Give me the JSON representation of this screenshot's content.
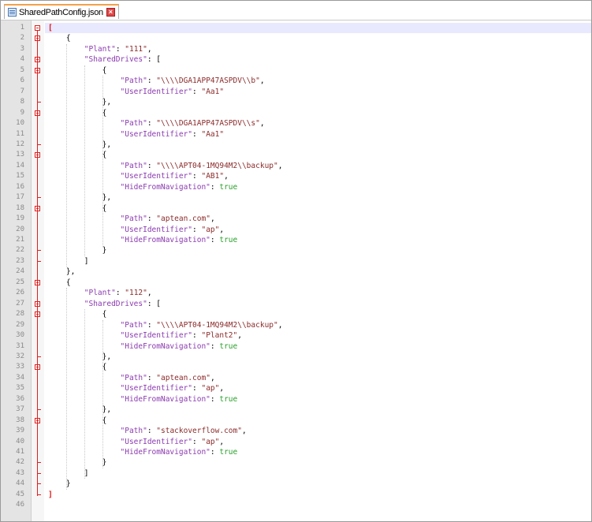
{
  "tab": {
    "filename": "SharedPathConfig.json"
  },
  "colors": {
    "key": "#8b3bb0",
    "string": "#8b2a2a",
    "boolean": "#2aa02a",
    "fold_marker": "#e02020",
    "tab_accent": "#f2a14b"
  },
  "icons": {
    "file": "file-icon",
    "close": "close-icon"
  },
  "lines": [
    [
      [
        "brace-hl",
        "["
      ]
    ],
    [
      [
        "p",
        "    {"
      ]
    ],
    [
      [
        "p",
        "        "
      ],
      [
        "k",
        "\"Plant\""
      ],
      [
        "p",
        ": "
      ],
      [
        "s",
        "\"111\""
      ],
      [
        "p",
        ","
      ]
    ],
    [
      [
        "p",
        "        "
      ],
      [
        "k",
        "\"SharedDrives\""
      ],
      [
        "p",
        ": ["
      ]
    ],
    [
      [
        "p",
        "            {"
      ]
    ],
    [
      [
        "p",
        "                "
      ],
      [
        "k",
        "\"Path\""
      ],
      [
        "p",
        ": "
      ],
      [
        "s",
        "\"\\\\\\\\DGA1APP47ASPDV\\\\b\""
      ],
      [
        "p",
        ","
      ]
    ],
    [
      [
        "p",
        "                "
      ],
      [
        "k",
        "\"UserIdentifier\""
      ],
      [
        "p",
        ": "
      ],
      [
        "s",
        "\"Aa1\""
      ]
    ],
    [
      [
        "p",
        "            },"
      ]
    ],
    [
      [
        "p",
        "            {"
      ]
    ],
    [
      [
        "p",
        "                "
      ],
      [
        "k",
        "\"Path\""
      ],
      [
        "p",
        ": "
      ],
      [
        "s",
        "\"\\\\\\\\DGA1APP47ASPDV\\\\s\""
      ],
      [
        "p",
        ","
      ]
    ],
    [
      [
        "p",
        "                "
      ],
      [
        "k",
        "\"UserIdentifier\""
      ],
      [
        "p",
        ": "
      ],
      [
        "s",
        "\"Aa1\""
      ]
    ],
    [
      [
        "p",
        "            },"
      ]
    ],
    [
      [
        "p",
        "            {"
      ]
    ],
    [
      [
        "p",
        "                "
      ],
      [
        "k",
        "\"Path\""
      ],
      [
        "p",
        ": "
      ],
      [
        "s",
        "\"\\\\\\\\APT04-1MQ94M2\\\\backup\""
      ],
      [
        "p",
        ","
      ]
    ],
    [
      [
        "p",
        "                "
      ],
      [
        "k",
        "\"UserIdentifier\""
      ],
      [
        "p",
        ": "
      ],
      [
        "s",
        "\"AB1\""
      ],
      [
        "p",
        ","
      ]
    ],
    [
      [
        "p",
        "                "
      ],
      [
        "k",
        "\"HideFromNavigation\""
      ],
      [
        "p",
        ": "
      ],
      [
        "b",
        "true"
      ]
    ],
    [
      [
        "p",
        "            },"
      ]
    ],
    [
      [
        "p",
        "            {"
      ]
    ],
    [
      [
        "p",
        "                "
      ],
      [
        "k",
        "\"Path\""
      ],
      [
        "p",
        ": "
      ],
      [
        "s",
        "\"aptean.com\""
      ],
      [
        "p",
        ","
      ]
    ],
    [
      [
        "p",
        "                "
      ],
      [
        "k",
        "\"UserIdentifier\""
      ],
      [
        "p",
        ": "
      ],
      [
        "s",
        "\"ap\""
      ],
      [
        "p",
        ","
      ]
    ],
    [
      [
        "p",
        "                "
      ],
      [
        "k",
        "\"HideFromNavigation\""
      ],
      [
        "p",
        ": "
      ],
      [
        "b",
        "true"
      ]
    ],
    [
      [
        "p",
        "            }"
      ]
    ],
    [
      [
        "p",
        "        ]"
      ]
    ],
    [
      [
        "p",
        "    },"
      ]
    ],
    [
      [
        "p",
        "    {"
      ]
    ],
    [
      [
        "p",
        "        "
      ],
      [
        "k",
        "\"Plant\""
      ],
      [
        "p",
        ": "
      ],
      [
        "s",
        "\"112\""
      ],
      [
        "p",
        ","
      ]
    ],
    [
      [
        "p",
        "        "
      ],
      [
        "k",
        "\"SharedDrives\""
      ],
      [
        "p",
        ": ["
      ]
    ],
    [
      [
        "p",
        "            {"
      ]
    ],
    [
      [
        "p",
        "                "
      ],
      [
        "k",
        "\"Path\""
      ],
      [
        "p",
        ": "
      ],
      [
        "s",
        "\"\\\\\\\\APT04-1MQ94M2\\\\backup\""
      ],
      [
        "p",
        ","
      ]
    ],
    [
      [
        "p",
        "                "
      ],
      [
        "k",
        "\"UserIdentifier\""
      ],
      [
        "p",
        ": "
      ],
      [
        "s",
        "\"Plant2\""
      ],
      [
        "p",
        ","
      ]
    ],
    [
      [
        "p",
        "                "
      ],
      [
        "k",
        "\"HideFromNavigation\""
      ],
      [
        "p",
        ": "
      ],
      [
        "b",
        "true"
      ]
    ],
    [
      [
        "p",
        "            },"
      ]
    ],
    [
      [
        "p",
        "            {"
      ]
    ],
    [
      [
        "p",
        "                "
      ],
      [
        "k",
        "\"Path\""
      ],
      [
        "p",
        ": "
      ],
      [
        "s",
        "\"aptean.com\""
      ],
      [
        "p",
        ","
      ]
    ],
    [
      [
        "p",
        "                "
      ],
      [
        "k",
        "\"UserIdentifier\""
      ],
      [
        "p",
        ": "
      ],
      [
        "s",
        "\"ap\""
      ],
      [
        "p",
        ","
      ]
    ],
    [
      [
        "p",
        "                "
      ],
      [
        "k",
        "\"HideFromNavigation\""
      ],
      [
        "p",
        ": "
      ],
      [
        "b",
        "true"
      ]
    ],
    [
      [
        "p",
        "            },"
      ]
    ],
    [
      [
        "p",
        "            {"
      ]
    ],
    [
      [
        "p",
        "                "
      ],
      [
        "k",
        "\"Path\""
      ],
      [
        "p",
        ": "
      ],
      [
        "s",
        "\"stackoverflow.com\""
      ],
      [
        "p",
        ","
      ]
    ],
    [
      [
        "p",
        "                "
      ],
      [
        "k",
        "\"UserIdentifier\""
      ],
      [
        "p",
        ": "
      ],
      [
        "s",
        "\"ap\""
      ],
      [
        "p",
        ","
      ]
    ],
    [
      [
        "p",
        "                "
      ],
      [
        "k",
        "\"HideFromNavigation\""
      ],
      [
        "p",
        ": "
      ],
      [
        "b",
        "true"
      ]
    ],
    [
      [
        "p",
        "            }"
      ]
    ],
    [
      [
        "p",
        "        ]"
      ]
    ],
    [
      [
        "p",
        "    }"
      ]
    ],
    [
      [
        "brace-hl",
        "]"
      ]
    ],
    [
      [
        "p",
        ""
      ]
    ]
  ]
}
